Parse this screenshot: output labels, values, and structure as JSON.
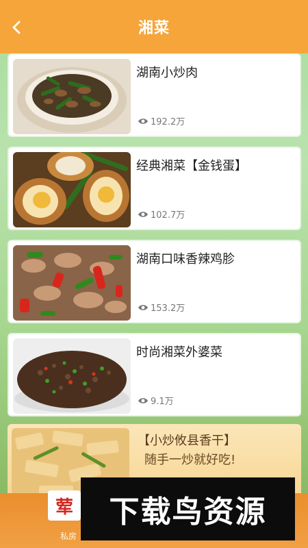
{
  "header": {
    "title": "湘菜",
    "back_icon": "chevron-left-icon"
  },
  "recipes": [
    {
      "name": "湖南小炒肉",
      "views": "192.2万"
    },
    {
      "name": "经典湘菜【金钱蛋】",
      "views": "102.7万"
    },
    {
      "name": "湖南口味香辣鸡胗",
      "views": "153.2万"
    },
    {
      "name": "时尚湘菜外婆菜",
      "views": "9.1万"
    }
  ],
  "ad": {
    "title": "【小炒攸县香干】",
    "subtitle": "随手一炒就好吃!"
  },
  "bottom": {
    "badge": "荤",
    "small_text": "私房"
  },
  "watermark": {
    "text": "下载鸟资源"
  },
  "colors": {
    "header": "#f5a53a",
    "background": "#b9e3ad",
    "card": "#ffffff",
    "watermark_bg": "#0c0c0c"
  }
}
